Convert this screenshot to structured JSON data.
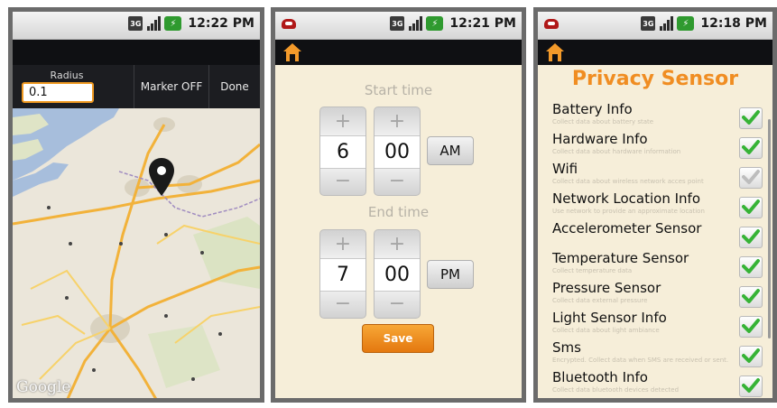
{
  "colors": {
    "accent": "#f08d22",
    "check": "#36b336"
  },
  "phones": [
    {
      "clock": "12:22 PM",
      "network": "3G",
      "battery_icon": "battery-icon"
    },
    {
      "clock": "12:21 PM",
      "network": "3G",
      "battery_icon": "battery-icon"
    },
    {
      "clock": "12:18 PM",
      "network": "3G",
      "battery_icon": "battery-icon"
    }
  ],
  "map_screen": {
    "radius_label": "Radius",
    "radius_value": "0.1",
    "marker_button": "Marker OFF",
    "done_button": "Done",
    "watermark": "Google"
  },
  "time_screen": {
    "start_label": "Start time",
    "start_hour": "6",
    "start_minute": "00",
    "start_ampm": "AM",
    "end_label": "End time",
    "end_hour": "7",
    "end_minute": "00",
    "end_ampm": "PM",
    "plus": "+",
    "minus": "−",
    "save_label": "Save"
  },
  "privacy_screen": {
    "title": "Privacy Sensor",
    "items": [
      {
        "name": "Battery Info",
        "desc": "Collect data about battery state",
        "checked": true
      },
      {
        "name": "Hardware Info",
        "desc": "Collect data about hardware information",
        "checked": true
      },
      {
        "name": "Wifi",
        "desc": "Collect data about wireless network acces point",
        "checked": true,
        "disabled": true
      },
      {
        "name": "Network Location Info",
        "desc": "Use network to provide an approximate location",
        "checked": true
      },
      {
        "name": "Accelerometer Sensor",
        "desc": "",
        "checked": true
      },
      {
        "name": "Temperature Sensor",
        "desc": "Collect temperature data",
        "checked": true
      },
      {
        "name": "Pressure Sensor",
        "desc": "Collect data external pressure",
        "checked": true
      },
      {
        "name": "Light Sensor Info",
        "desc": "Collect data about light ambiance",
        "checked": true
      },
      {
        "name": "Sms",
        "desc": "Encrypted. Collect data when SMS are received or sent.",
        "checked": true
      },
      {
        "name": "Bluetooth Info",
        "desc": "Collect data bluetooth devices detected",
        "checked": true
      }
    ]
  }
}
